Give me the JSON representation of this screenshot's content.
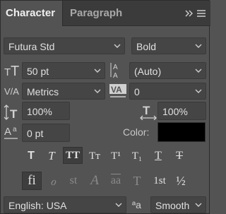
{
  "tabs": {
    "character": "Character",
    "paragraph": "Paragraph"
  },
  "font": {
    "family": "Futura Std",
    "style": "Bold"
  },
  "size": {
    "font_size": "50 pt",
    "leading": "(Auto)"
  },
  "spacing": {
    "kerning": "Metrics",
    "tracking": "0"
  },
  "scale": {
    "vertical": "100%",
    "horizontal": "100%"
  },
  "baseline": {
    "shift": "0 pt"
  },
  "color": {
    "label": "Color:",
    "value": "#000000"
  },
  "style_buttons": [
    "T",
    "T",
    "TT",
    "Tт",
    "T¹",
    "T₁",
    "T",
    "T"
  ],
  "opentype_buttons": [
    "fi",
    "ℴ",
    "st",
    "A",
    "aa",
    "T",
    "1st",
    "½"
  ],
  "footer": {
    "language": "English: USA",
    "aa_label": "ªa",
    "antialias": "Smooth"
  }
}
